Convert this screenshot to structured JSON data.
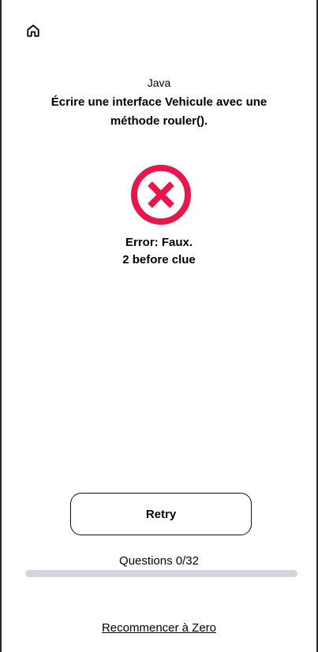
{
  "nav": {
    "home_icon": "home-icon"
  },
  "quiz": {
    "subject": "Java",
    "question": "Écrire une interface Vehicule avec une méthode rouler()."
  },
  "result": {
    "icon": "error-x-circle-icon",
    "icon_color": "#e8174b",
    "status": "Error: Faux.",
    "clue_info": "2 before clue"
  },
  "actions": {
    "retry_label": "Retry",
    "restart_label": "Recommencer à Zero"
  },
  "progress": {
    "label": "Questions 0/32",
    "fraction": 0
  }
}
